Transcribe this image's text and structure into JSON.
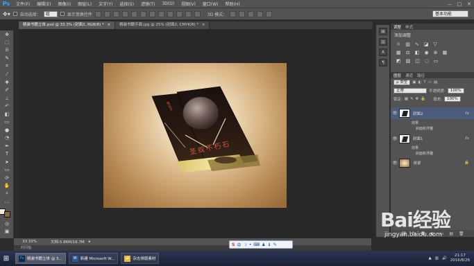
{
  "menubar": {
    "logo": "Ps",
    "items": [
      "文件(F)",
      "编辑(E)",
      "图像(I)",
      "图层(L)",
      "文字(Y)",
      "选择(S)",
      "滤镜(T)",
      "3D(D)",
      "视图(V)",
      "窗口(W)",
      "帮助(H)"
    ],
    "controls": [
      "—",
      "□",
      "✕"
    ]
  },
  "options": {
    "auto_select_label": "自动选择：",
    "auto_select_value": "组",
    "show_transform_label": "显示变换控件",
    "mode_3d_label": "3D 模式：",
    "workspace": "基本功能"
  },
  "tabs": [
    {
      "label": "精装书籍立体.psd @ 33.3% (封面2, RGB/8) *",
      "close": "×",
      "active": true
    },
    {
      "label": "精装书籍平面.jpg @ 25% (封面2, CMYK/8) *",
      "close": "×",
      "active": false
    }
  ],
  "status": {
    "zoom": "33.33%",
    "doc_size": "文档:5.86M/18.7M"
  },
  "timeline_label": "时间轴",
  "ime": {
    "s": "S",
    "lang": "中"
  },
  "artwork": {
    "vertical_text": "鬼谷子",
    "title_text": "圣蚁不朽石"
  },
  "panels": {
    "adjust_tabs": [
      "调整",
      "样式"
    ],
    "adjust_title": "添加调整",
    "layer_tabs": [
      "图层",
      "通道",
      "路径"
    ],
    "kind_label": "ρ 类型",
    "blend_mode": "正常",
    "opacity_label": "不透明度:",
    "opacity_value": "100%",
    "lock_label": "锁定:",
    "fill_label": "填充:",
    "fill_value": "100%"
  },
  "layers": [
    {
      "name": "封面2",
      "fx": "fx",
      "effects_label": "效果",
      "effect": "斜面和浮雕"
    },
    {
      "name": "封面1",
      "fx": "fx",
      "effects_label": "效果",
      "effect": "斜面和浮雕"
    },
    {
      "name": "背景",
      "lock": "🔒"
    }
  ],
  "taskbar": {
    "items": [
      {
        "label": "精装书籍立体 @ 3...",
        "icon": "Ps",
        "active": true
      },
      {
        "label": "新建 Microsoft W...",
        "icon": "W",
        "active": false
      },
      {
        "label": "杂志排版素材",
        "icon": "📁",
        "active": false
      }
    ],
    "time": "21:17",
    "date": "2016/8/26"
  },
  "watermark": {
    "logo": "Bai经验",
    "url": "jingyan.baidu.com"
  },
  "colors": {
    "ps_blue": "#31a8ff",
    "panel_gray": "#535353",
    "canvas_bg": "#282828",
    "selected_layer": "#4b5d7a"
  }
}
